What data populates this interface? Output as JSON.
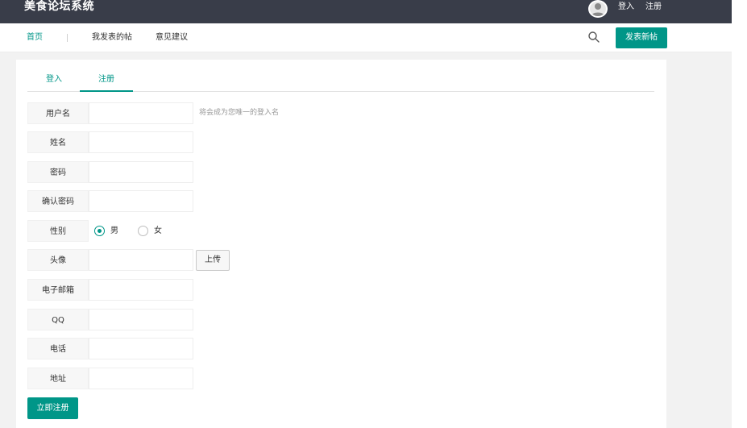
{
  "header": {
    "brand": "美食论坛系统",
    "login_link": "登入",
    "register_link": "注册"
  },
  "nav": {
    "home": "首页",
    "my_posts": "我发表的帖",
    "feedback": "意见建议",
    "new_post": "发表新帖"
  },
  "tabs": {
    "login": "登入",
    "register": "注册",
    "active": "注册"
  },
  "form": {
    "username_label": "用户名",
    "username_value": "",
    "username_hint": "将会成为您唯一的登入名",
    "name_label": "姓名",
    "name_value": "",
    "password_label": "密码",
    "password_value": "",
    "confirm_label": "确认密码",
    "confirm_value": "",
    "gender_label": "性别",
    "gender_male": "男",
    "gender_female": "女",
    "gender_selected": "男",
    "avatar_label": "头像",
    "avatar_value": "",
    "upload_button": "上传",
    "email_label": "电子邮箱",
    "email_value": "",
    "qq_label": "QQ",
    "qq_value": "",
    "phone_label": "电话",
    "phone_value": "",
    "address_label": "地址",
    "address_value": "",
    "submit": "立即注册"
  },
  "colors": {
    "accent": "#009688",
    "topbar": "#393d49"
  }
}
